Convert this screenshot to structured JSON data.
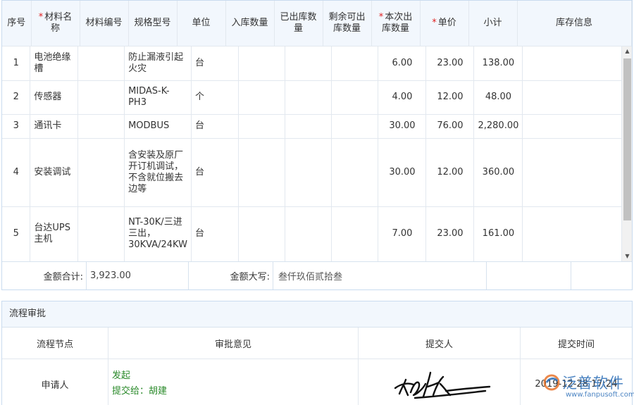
{
  "table": {
    "headers": {
      "seq": "序号",
      "name": "材料名称",
      "code": "材料编号",
      "spec": "规格型号",
      "unit": "单位",
      "in_qty": "入库数量",
      "out_qty": "已出库数量",
      "remain_qty": "剩余可出库数量",
      "this_qty": "本次出库数量",
      "price": "单价",
      "subtotal": "小计",
      "stock": "库存信息"
    },
    "required_mark": "*",
    "rows": [
      {
        "seq": "1",
        "name": "电池绝缘槽",
        "code": "",
        "spec": "防止漏液引起火灾",
        "unit": "台",
        "in_qty": "",
        "out_qty": "",
        "remain_qty": "",
        "this_qty": "6.00",
        "price": "23.00",
        "subtotal": "138.00",
        "stock": ""
      },
      {
        "seq": "2",
        "name": "传感器",
        "code": "",
        "spec": "MIDAS-K-PH3",
        "unit": "个",
        "in_qty": "",
        "out_qty": "",
        "remain_qty": "",
        "this_qty": "4.00",
        "price": "12.00",
        "subtotal": "48.00",
        "stock": ""
      },
      {
        "seq": "3",
        "name": "通讯卡",
        "code": "",
        "spec": "MODBUS",
        "unit": "台",
        "in_qty": "",
        "out_qty": "",
        "remain_qty": "",
        "this_qty": "30.00",
        "price": "76.00",
        "subtotal": "2,280.00",
        "stock": ""
      },
      {
        "seq": "4",
        "name": "安装调试",
        "code": "",
        "spec": "含安装及原厂开订机调试，不含就位搬去边等",
        "unit": "台",
        "in_qty": "",
        "out_qty": "",
        "remain_qty": "",
        "this_qty": "30.00",
        "price": "12.00",
        "subtotal": "360.00",
        "stock": ""
      },
      {
        "seq": "5",
        "name": "台达UPS主机",
        "code": "",
        "spec": "NT-30K/三进三出，30KVA/24KW",
        "unit": "台",
        "in_qty": "",
        "out_qty": "",
        "remain_qty": "",
        "this_qty": "7.00",
        "price": "23.00",
        "subtotal": "161.00",
        "stock": ""
      }
    ],
    "summary": {
      "total_label": "金额合计:",
      "total_value": "3,923.00",
      "upper_label": "金额大写:",
      "upper_value": "叁仟玖佰贰拾叁"
    }
  },
  "flow": {
    "title": "流程审批",
    "columns": {
      "node": "流程节点",
      "opinion": "审批意见",
      "submitter": "提交人",
      "time": "提交时间"
    },
    "rows": [
      {
        "node": "申请人",
        "opinion_line1": "发起",
        "opinion_line2": "提交给：胡建",
        "time": "2019-12-28 17:24"
      }
    ]
  },
  "watermark": {
    "brand": "泛普软件",
    "url": "www.fanpusoft.com"
  },
  "colors": {
    "header_bg": "#f2f7fd",
    "border": "#c9dbef",
    "required": "#e02020",
    "opinion_text": "#2a8a2a",
    "brand": "#2d6fb8"
  }
}
